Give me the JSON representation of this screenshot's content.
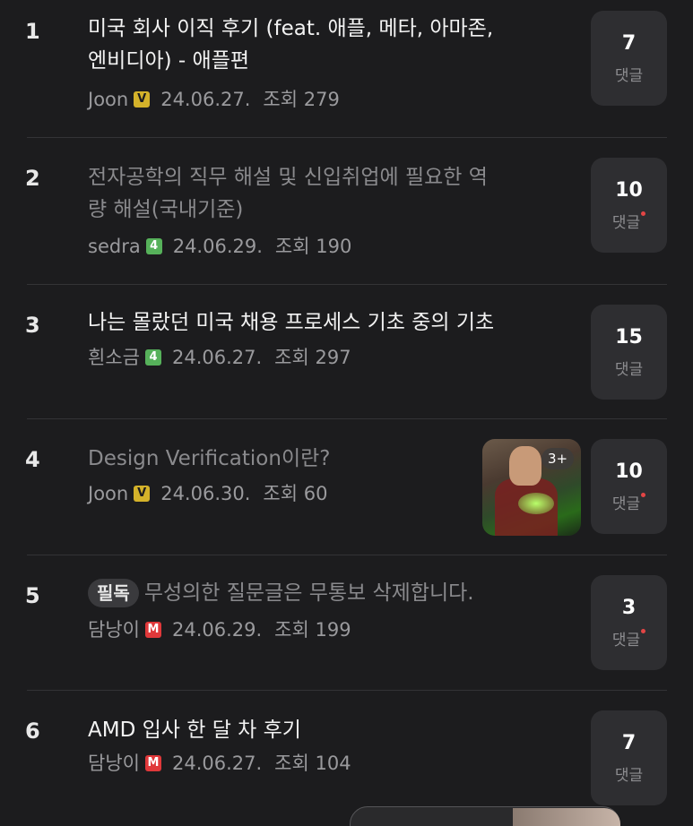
{
  "posts": [
    {
      "rank": "1",
      "title_line1": "미국 회사 이직 후기 (feat. 애플, 메타, 아마존,",
      "title_line2": "엔비디아) - 애플편",
      "author": "Joon",
      "badge": "V",
      "date": "24.06.27.",
      "views": "조회 279",
      "comments": "7",
      "comments_label": "댓글",
      "read": false,
      "new_comment": false
    },
    {
      "rank": "2",
      "title_line1": "전자공학의 직무 해설 및 신입취업에 필요한 역",
      "title_line2": "량 해설(국내기준)",
      "author": "sedra",
      "badge": "4",
      "date": "24.06.29.",
      "views": "조회 190",
      "comments": "10",
      "comments_label": "댓글",
      "read": true,
      "new_comment": true
    },
    {
      "rank": "3",
      "title_line1": "나는 몰랐던 미국 채용 프로세스 기초 중의 기초",
      "author": "흰소금",
      "badge": "4",
      "date": "24.06.27.",
      "views": "조회 297",
      "comments": "15",
      "comments_label": "댓글",
      "read": false,
      "new_comment": false
    },
    {
      "rank": "4",
      "title_line1": "Design Verification이란?",
      "author": "Joon",
      "badge": "V",
      "date": "24.06.30.",
      "views": "조회 60",
      "comments": "10",
      "comments_label": "댓글",
      "thumb_count": "3+",
      "read": true,
      "new_comment": true
    },
    {
      "rank": "5",
      "tag": "필독",
      "title_line1": "무성의한 질문글은 무통보 삭제합니다.",
      "author": "담낭이",
      "badge": "M",
      "date": "24.06.29.",
      "views": "조회 199",
      "comments": "3",
      "comments_label": "댓글",
      "read": true,
      "new_comment": true
    },
    {
      "rank": "6",
      "title_line1": "AMD 입사 한 달 차 후기",
      "author": "담낭이",
      "badge": "M",
      "date": "24.06.27.",
      "views": "조회 104",
      "comments": "7",
      "comments_label": "댓글",
      "read": false,
      "new_comment": false
    }
  ],
  "colors": {
    "background": "#1c1c1e",
    "badge_v": "#d4b22a",
    "badge_level": "#56b15a",
    "badge_m": "#e0383a",
    "new_dot": "#e34545"
  }
}
